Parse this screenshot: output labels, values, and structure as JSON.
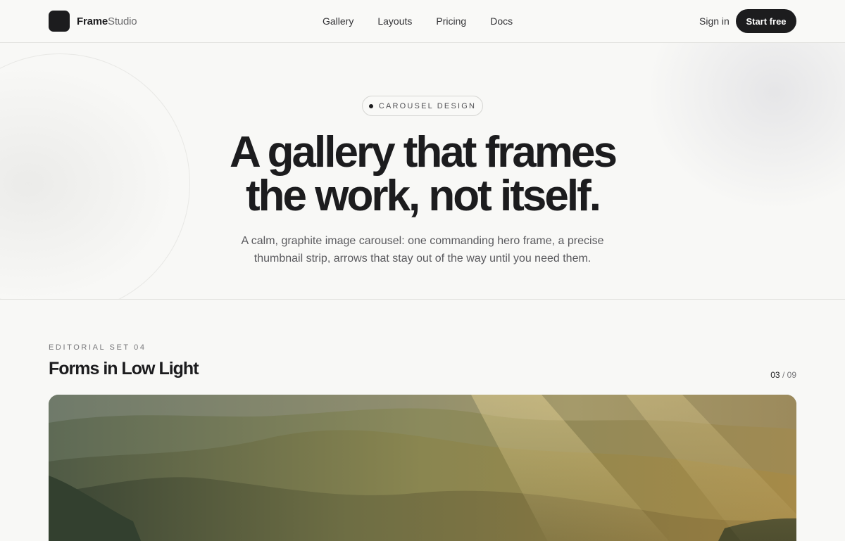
{
  "header": {
    "brand_strong": "Frame",
    "brand_light": "Studio",
    "nav": [
      "Gallery",
      "Layouts",
      "Pricing",
      "Docs"
    ],
    "sign_in": "Sign in",
    "cta": "Start free"
  },
  "hero": {
    "eyebrow": "CAROUSEL DESIGN",
    "title_line1": "A gallery that frames",
    "title_line2": "the work, not itself.",
    "subtitle_line1": "A calm, graphite image carousel: one commanding hero frame, a precise",
    "subtitle_line2": "thumbnail strip, arrows that stay out of the way until you need them."
  },
  "gallery": {
    "eyebrow": "EDITORIAL SET 04",
    "title": "Forms in Low Light",
    "current": "03",
    "separator": "/",
    "total": "09"
  },
  "colors": {
    "ink": "#1c1c1e",
    "background": "#f8f8f6",
    "border": "#e3e3e0"
  }
}
